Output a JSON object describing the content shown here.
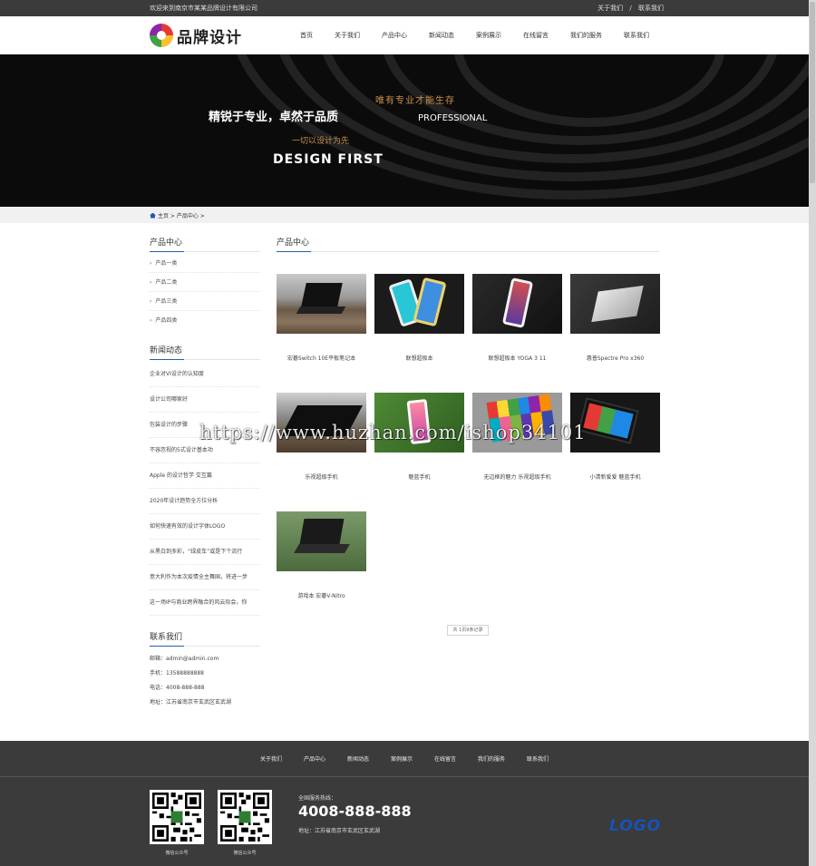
{
  "topbar": {
    "welcome": "欢迎来到南京市某某品牌设计有限公司",
    "links": [
      "关于我们",
      "/",
      "联系我们"
    ]
  },
  "header": {
    "logo_text": "品牌设计",
    "nav": [
      "首页",
      "关于我们",
      "产品中心",
      "新闻动态",
      "案例展示",
      "在线留言",
      "我们的服务",
      "联系我们"
    ]
  },
  "banner": {
    "main": "精锐于专业，卓然于品质",
    "tagline": "唯有专业才能生存",
    "en1": "PROFESSIONAL",
    "sub": "一切以设计为先",
    "en2": "DESIGN FIRST"
  },
  "breadcrumb": {
    "text": "主页 > 产品中心 >"
  },
  "sidebar": {
    "products_title": "产品中心",
    "categories": [
      "产品一类",
      "产品二类",
      "产品三类",
      "产品四类"
    ],
    "news_title": "新闻动态",
    "news": [
      "企业对VI设计的认知度",
      "设计公司哪家好",
      "包装设计的步骤",
      "不容忽视的5式设计基本功",
      "Apple 的设计哲学 交互篇",
      "2020年设计趋势全方位分析",
      "如何快速有效的设计字体LOGO",
      "从黑白到多彩，“绿皮车”或是下个流行",
      "意大利作为本次疫情全主舞国，将进一步",
      "这一场IP与商业跨界融合的风云际会，你"
    ],
    "contact_title": "联系我们",
    "contact": [
      "邮箱：admin@admin.com",
      "手机：13588888888",
      "电话：4008-888-888",
      "地址：江苏省南京市玄武区玄武湖"
    ]
  },
  "main": {
    "title": "产品中心",
    "products": [
      {
        "name": "宏碁Switch 10E平板笔记本",
        "img": "laptop-on-bench"
      },
      {
        "name": "联想超极本",
        "img": "two-phones"
      },
      {
        "name": "联想超极本 YOGA 3 11",
        "img": "phone-on-wood"
      },
      {
        "name": "惠普Spectre Pro x360",
        "img": "silver-laptop"
      },
      {
        "name": "乐视超级手机",
        "img": "tablet-on-bench"
      },
      {
        "name": "魅蓝手机",
        "img": "phone-in-grass"
      },
      {
        "name": "无边框的魅力 乐视超级手机",
        "img": "color-tiles"
      },
      {
        "name": "小清新爱爱 魅蓝手机",
        "img": "windows-tablet"
      },
      {
        "name": "游戏本 宏碁V-Nitro",
        "img": "laptop-in-grass"
      }
    ],
    "pager": "共 1页9条记录"
  },
  "watermark": "https://www.huzhan.com/ishop34101",
  "footer": {
    "nav": [
      "关于我们",
      "产品中心",
      "新闻动态",
      "案例展示",
      "在线留言",
      "我们的服务",
      "联系我们"
    ],
    "qr_captions": [
      "微信公众号",
      "微信公众号"
    ],
    "hotline_label": "全国服务热线：",
    "hotline": "4008-888-888",
    "address": "地址：江苏省南京市玄武区玄武湖",
    "logo": "LOGO"
  },
  "colors": {
    "accent": "#2a5dab",
    "dark_bar": "#3b3b3b",
    "banner_gold": "#c8904a",
    "footer_logo": "#1653b8"
  }
}
